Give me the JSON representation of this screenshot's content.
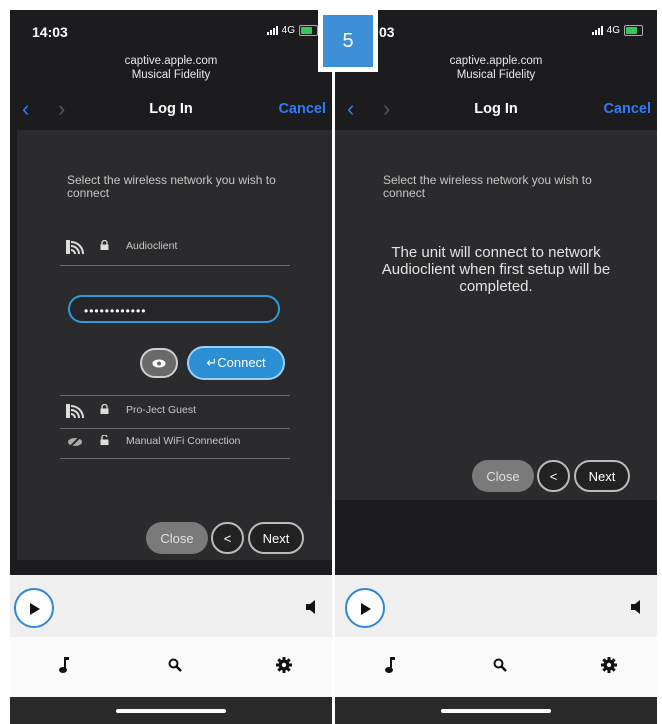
{
  "badge": "5",
  "left": {
    "time": "14:03",
    "network": "4G",
    "url_host": "captive.apple.com",
    "url_name": "Musical Fidelity",
    "nav": {
      "back": "‹",
      "forward": "›",
      "title": "Log In",
      "cancel": "Cancel"
    },
    "prompt": "Select the wireless network you wish to connect",
    "networks": [
      {
        "name": "Audioclient",
        "icon": "wifi-icon",
        "lock": "locked"
      },
      {
        "name": "Pro-Ject Guest",
        "icon": "wifi-icon",
        "lock": "locked"
      },
      {
        "name": "Manual WiFi Connection",
        "icon": "eye-icon",
        "lock": "unlocked"
      }
    ],
    "password_value": "••••••••••••",
    "connect_label": "↵Connect",
    "close_label": "Close",
    "prev_label": "<",
    "next_label": "Next"
  },
  "right": {
    "time": "03",
    "network": "4G",
    "url_host": "captive.apple.com",
    "url_name": "Musical Fidelity",
    "nav": {
      "back": "‹",
      "forward": "›",
      "title": "Log In",
      "cancel": "Cancel"
    },
    "prompt": "Select the wireless network you wish to connect",
    "message": "The unit will connect to network Audioclient when first setup will be completed.",
    "close_label": "Close",
    "prev_label": "<",
    "next_label": "Next"
  },
  "colors": {
    "accent": "#2f7cf6",
    "connect": "#2b8fd6",
    "battery": "#34c759"
  }
}
